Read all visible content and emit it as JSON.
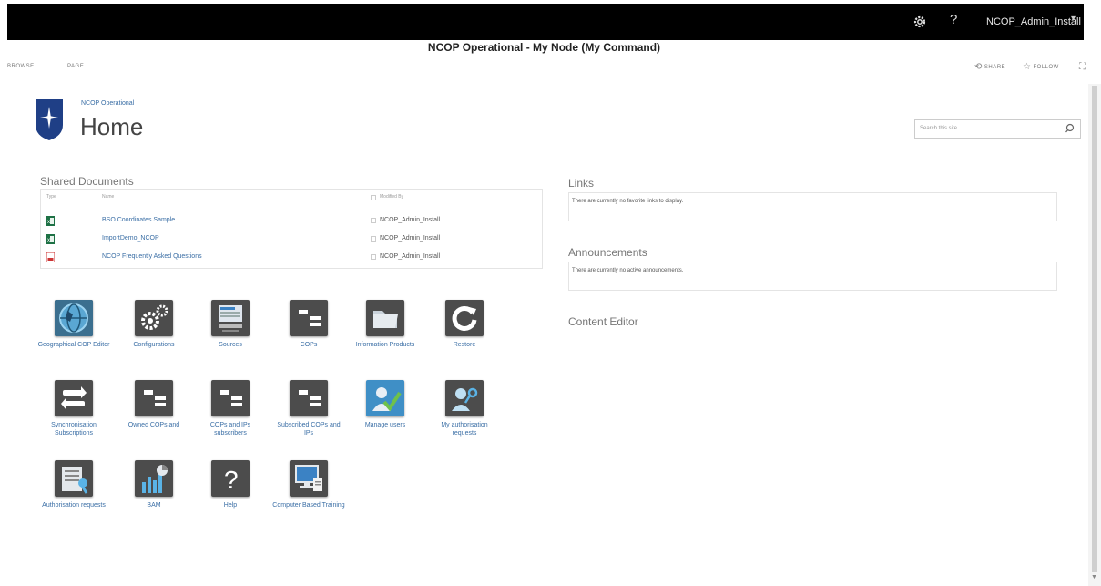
{
  "suitebar": {
    "user": "NCOP_Admin_Install",
    "help": "?",
    "caret": "▾"
  },
  "page_title": "NCOP Operational - My Node (My Command)",
  "ribbon": {
    "tabs": [
      "BROWSE",
      "PAGE"
    ],
    "share": "SHARE",
    "follow": "FOLLOW"
  },
  "site": {
    "name": "NCOP Operational",
    "title": "Home",
    "search_placeholder": "Search this site"
  },
  "documents": {
    "title": "Shared Documents",
    "headers": {
      "type": "Type",
      "name": "Name",
      "modified_by": "Modified By"
    },
    "rows": [
      {
        "name": "BSO Coordinates Sample",
        "modified_by": "NCOP_Admin_Install",
        "icon": "excel-icon"
      },
      {
        "name": "ImportDemo_NCOP",
        "modified_by": "NCOP_Admin_Install",
        "icon": "excel-icon"
      },
      {
        "name": "NCOP Frequently Asked Questions",
        "modified_by": "NCOP_Admin_Install",
        "icon": "pdf-icon"
      }
    ]
  },
  "links": {
    "title": "Links",
    "message": "There are currently no favorite links to display."
  },
  "announcements": {
    "title": "Announcements",
    "message": "There are currently no active announcements."
  },
  "content_editor": {
    "title": "Content Editor"
  },
  "tiles": [
    {
      "label": "Geographical COP Editor",
      "icon": "globe-icon"
    },
    {
      "label": "Configurations",
      "icon": "gears-icon"
    },
    {
      "label": "Sources",
      "icon": "server-icon"
    },
    {
      "label": "COPs",
      "icon": "cop-icon"
    },
    {
      "label": "Information Products",
      "icon": "folder-icon"
    },
    {
      "label": "Restore",
      "icon": "restore-icon"
    },
    {
      "label": "Synchronisation Subscriptions",
      "icon": "sync-icon"
    },
    {
      "label": "Owned COPs and",
      "icon": "cop-icon"
    },
    {
      "label": "COPs and IPs subscribers",
      "icon": "cop-icon"
    },
    {
      "label": "Subscribed COPs and IPs",
      "icon": "cop-icon"
    },
    {
      "label": "Manage users",
      "icon": "manage-users-icon"
    },
    {
      "label": "My authorisation requests",
      "icon": "user-key-icon"
    },
    {
      "label": "Authorisation requests",
      "icon": "auth-requests-icon"
    },
    {
      "label": "BAM",
      "icon": "bam-chart-icon"
    },
    {
      "label": "Help",
      "icon": "help-icon"
    },
    {
      "label": "Computer Based Training",
      "icon": "computer-icon"
    }
  ]
}
